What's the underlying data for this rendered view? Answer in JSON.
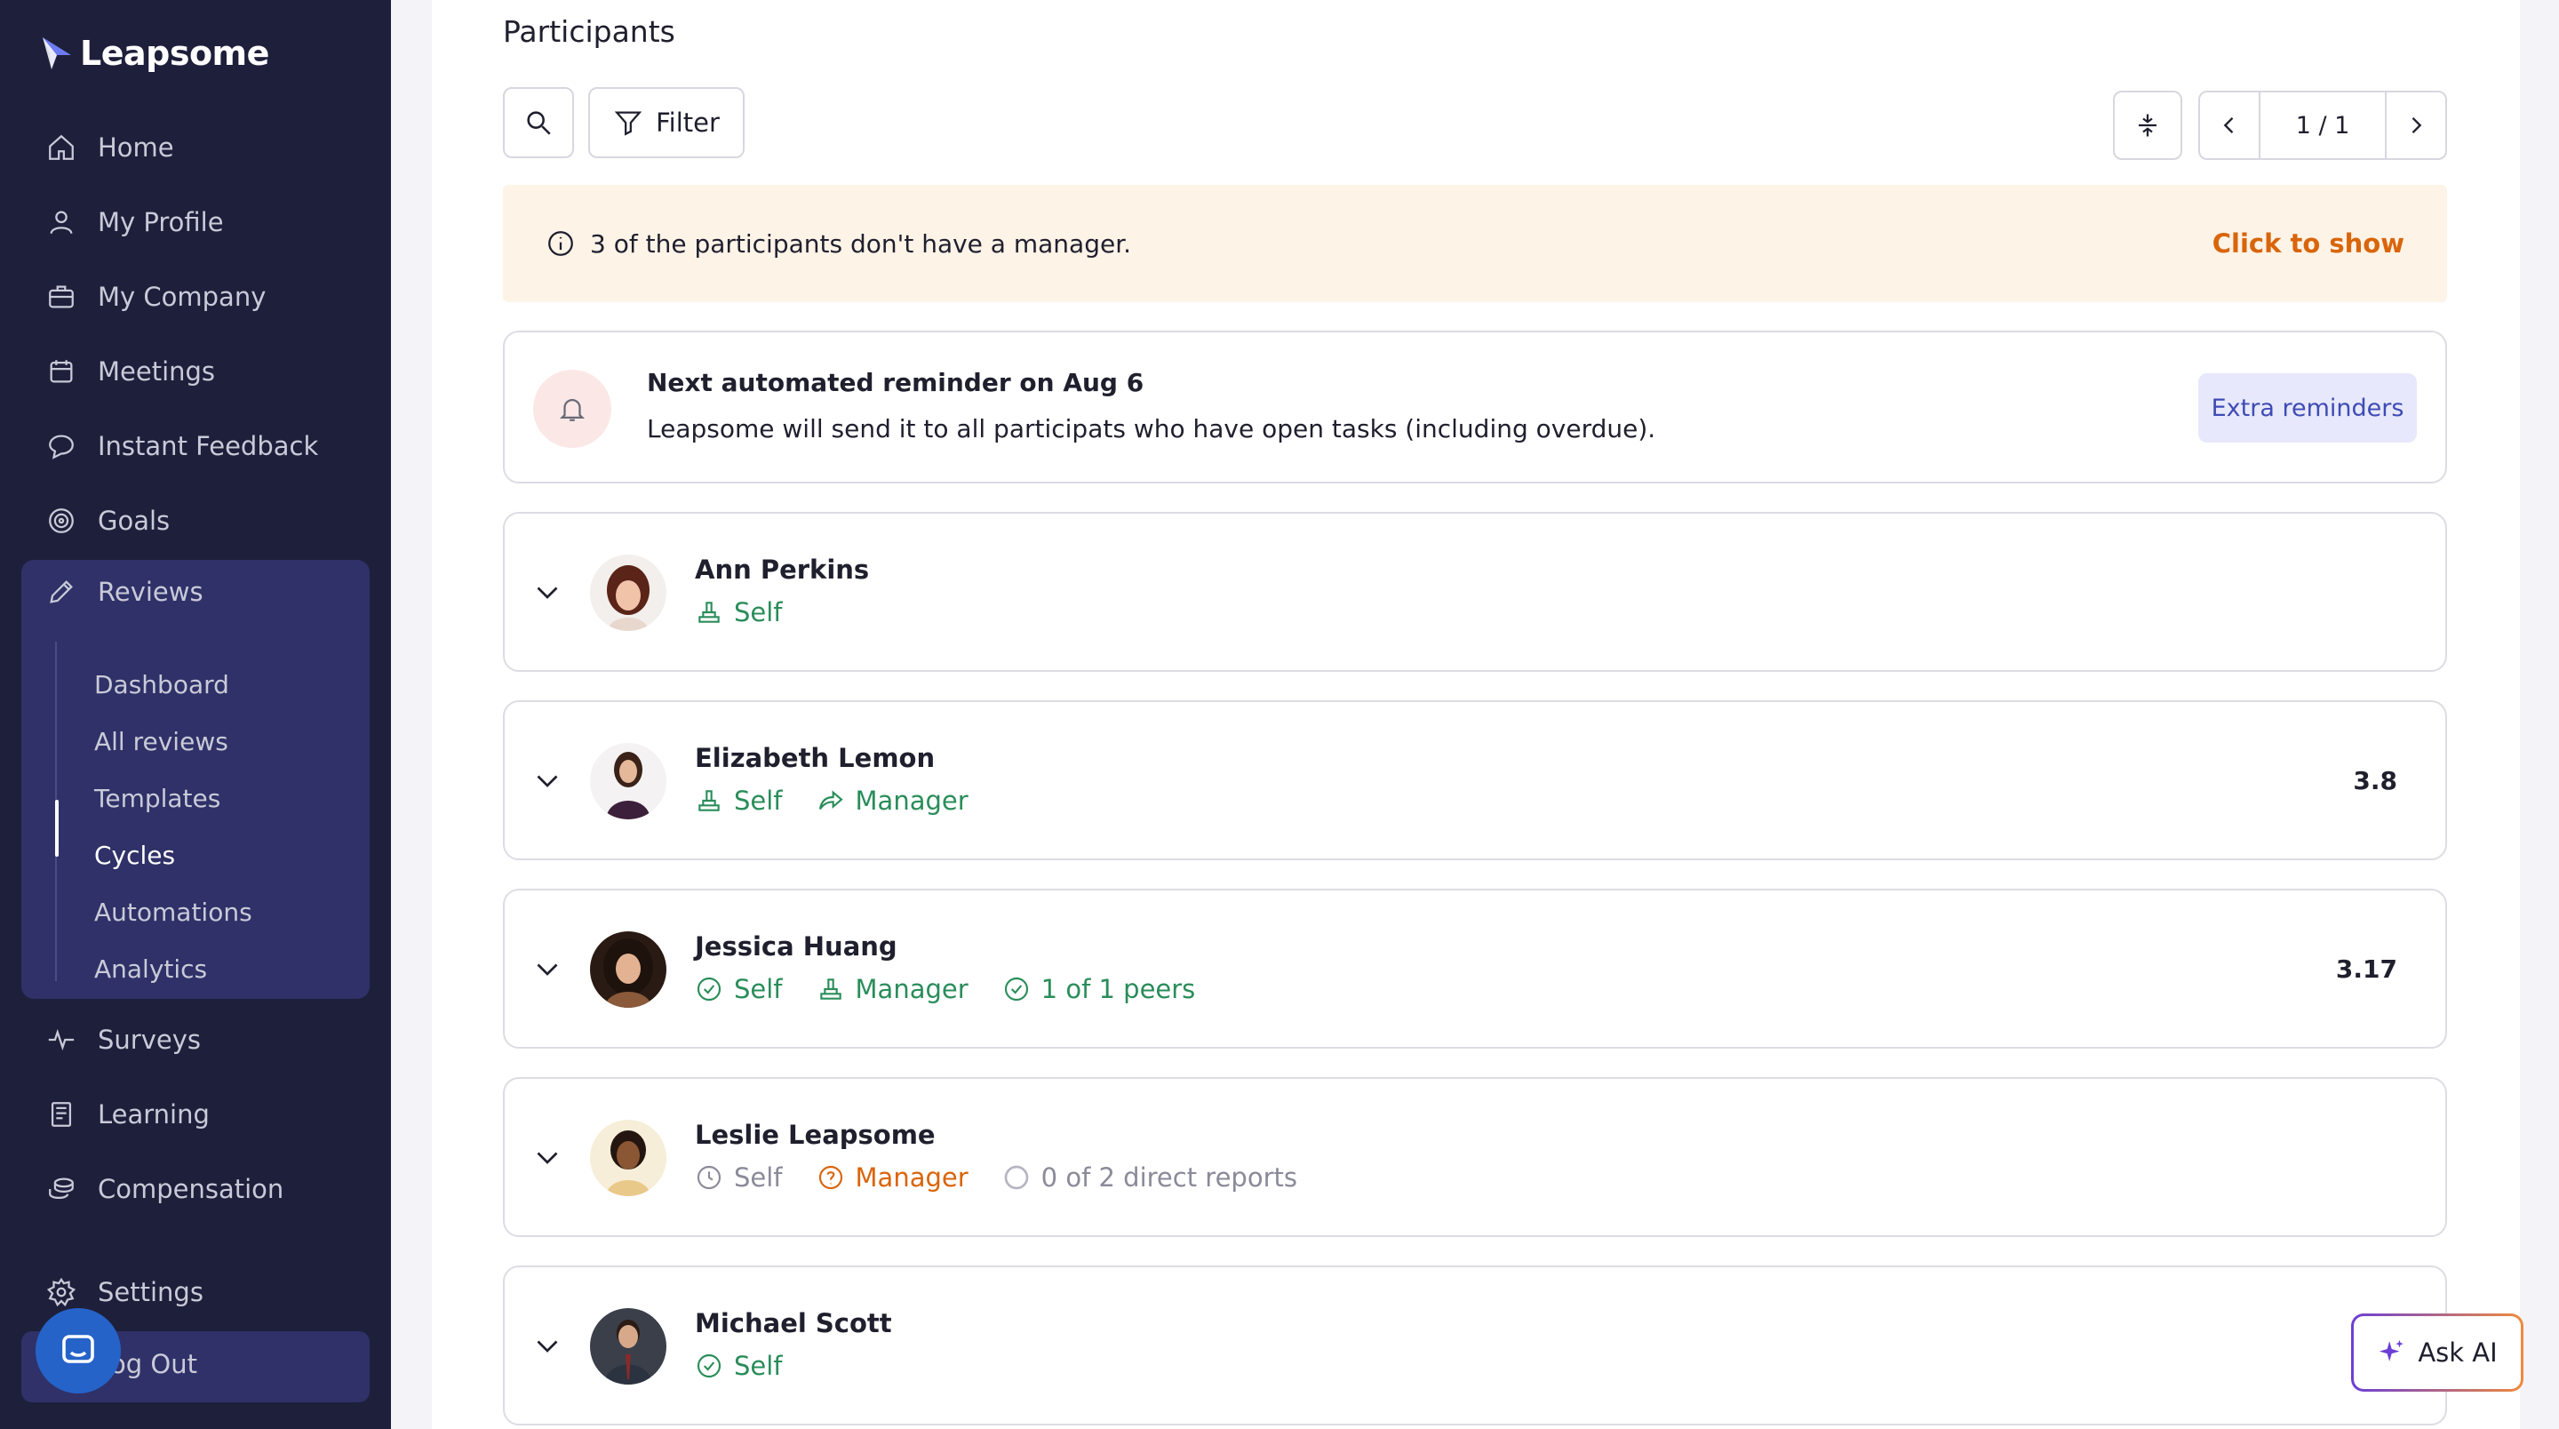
{
  "app": {
    "name": "Leapsome"
  },
  "sidebar": {
    "items": [
      {
        "label": "Home",
        "icon": "home-icon"
      },
      {
        "label": "My Profile",
        "icon": "user-icon"
      },
      {
        "label": "My Company",
        "icon": "briefcase-icon"
      },
      {
        "label": "Meetings",
        "icon": "calendar-icon"
      },
      {
        "label": "Instant Feedback",
        "icon": "chat-icon"
      },
      {
        "label": "Goals",
        "icon": "target-icon"
      },
      {
        "label": "Reviews",
        "icon": "pencil-icon"
      },
      {
        "label": "Surveys",
        "icon": "pulse-icon"
      },
      {
        "label": "Learning",
        "icon": "book-icon"
      },
      {
        "label": "Compensation",
        "icon": "coins-icon"
      },
      {
        "label": "Settings",
        "icon": "gear-icon"
      },
      {
        "label": "Log Out",
        "icon": "logout-icon"
      }
    ],
    "reviews_sub": [
      "Dashboard",
      "All reviews",
      "Templates",
      "Cycles",
      "Automations",
      "Analytics"
    ],
    "active_sub": "Cycles",
    "logout_visible": "og Out"
  },
  "main": {
    "section_title": "Participants",
    "filter_label": "Filter",
    "pager": "1 / 1",
    "notice": {
      "text": "3 of the participants don't have a manager.",
      "action": "Click to show"
    },
    "reminder": {
      "title": "Next automated reminder on Aug 6",
      "subtitle": "Leapsome will send it to all participats who have open tasks (including overdue).",
      "button": "Extra reminders"
    },
    "participants": [
      {
        "name": "Ann Perkins",
        "steps": [
          {
            "label": "Self",
            "icon": "hand-icon",
            "color": "green"
          }
        ],
        "score": ""
      },
      {
        "name": "Elizabeth Lemon",
        "steps": [
          {
            "label": "Self",
            "icon": "hand-icon",
            "color": "green"
          },
          {
            "label": "Manager",
            "icon": "share-icon",
            "color": "green"
          }
        ],
        "score": "3.8"
      },
      {
        "name": "Jessica Huang",
        "steps": [
          {
            "label": "Self",
            "icon": "check-circle-icon",
            "color": "green"
          },
          {
            "label": "Manager",
            "icon": "hand-icon",
            "color": "green"
          },
          {
            "label": "1 of 1 peers",
            "icon": "check-circle-icon",
            "color": "green"
          }
        ],
        "score": "3.17"
      },
      {
        "name": "Leslie Leapsome",
        "steps": [
          {
            "label": "Self",
            "icon": "clock-icon",
            "color": "gray"
          },
          {
            "label": "Manager",
            "icon": "question-icon",
            "color": "orange"
          },
          {
            "label": "0 of 2 direct reports",
            "icon": "empty-circle-icon",
            "color": "gray"
          }
        ],
        "score": ""
      },
      {
        "name": "Michael Scott",
        "steps": [
          {
            "label": "Self",
            "icon": "check-circle-icon",
            "color": "green"
          }
        ],
        "score": ""
      }
    ]
  },
  "ask_ai": {
    "label": "Ask AI"
  },
  "colors": {
    "sidebar": "#1e1f3b",
    "active_group": "#2f3168",
    "green": "#2a8d5a",
    "orange": "#d9650a",
    "accent": "#3e4bb4"
  }
}
